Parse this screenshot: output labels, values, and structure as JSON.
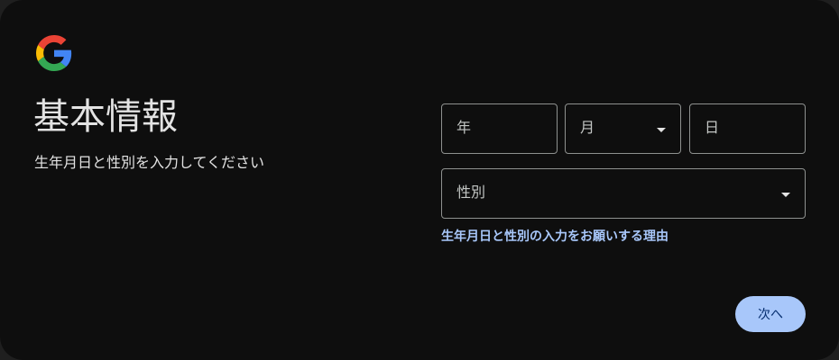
{
  "page": {
    "title": "基本情報",
    "subtitle": "生年月日と性別を入力してください"
  },
  "logo": {
    "icon": "google-g-icon",
    "colors": {
      "blue": "#4285f4",
      "red": "#ea4335",
      "yellow": "#fbbc05",
      "green": "#34a853"
    }
  },
  "form": {
    "year_label": "年",
    "month_label": "月",
    "day_label": "日",
    "gender_label": "性別",
    "why_link": "生年月日と性別の入力をお願いする理由"
  },
  "actions": {
    "next_label": "次へ"
  },
  "colors": {
    "background": "#0e0e0e",
    "text": "#e3e3e3",
    "field_border": "#8e918f",
    "link": "#a8c7fa",
    "button_bg": "#a8c7fa",
    "button_text": "#062e6f"
  }
}
